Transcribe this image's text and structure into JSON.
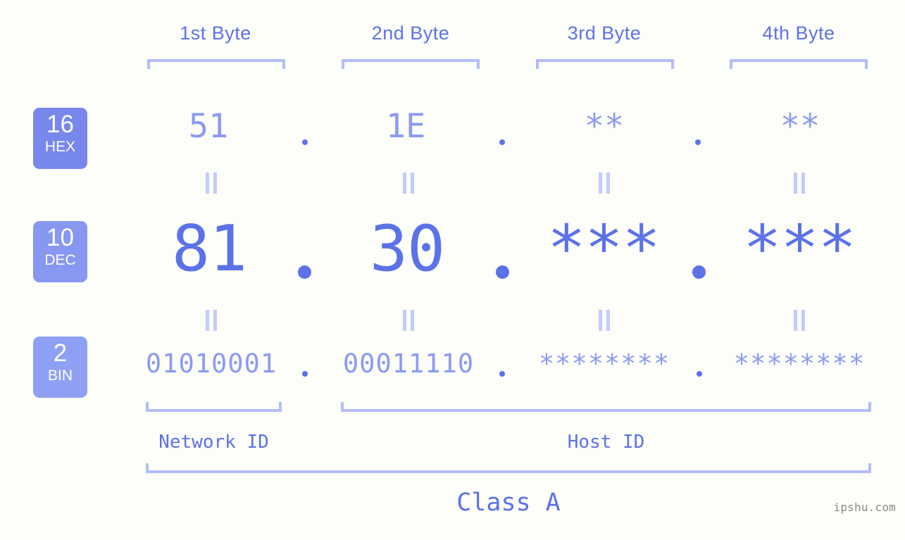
{
  "watermark": "ipshu.com",
  "byte_headers": [
    {
      "label": "1st Byte"
    },
    {
      "label": "2nd Byte"
    },
    {
      "label": "3rd Byte"
    },
    {
      "label": "4th Byte"
    }
  ],
  "bases": [
    {
      "number": "16",
      "name": "HEX",
      "color": "#7787ec"
    },
    {
      "number": "10",
      "name": "DEC",
      "color": "#8897ef"
    },
    {
      "number": "2",
      "name": "BIN",
      "color": "#8fa0f4"
    }
  ],
  "rows": {
    "hex": {
      "values": [
        "51",
        "1E",
        "**",
        "**"
      ]
    },
    "dec": {
      "values": [
        "81",
        "30",
        "***",
        "***"
      ]
    },
    "bin": {
      "values": [
        "01010001",
        "00011110",
        "********",
        "********"
      ]
    }
  },
  "separator": ".",
  "equality_symbol": "=",
  "segments": {
    "network_id": "Network ID",
    "host_id": "Host ID",
    "class": "Class A"
  },
  "colors": {
    "background": "#fdfdfa",
    "accent_strong": "#5c72e8",
    "accent_light": "#8b9bf2",
    "bracket": "#b3bdf7",
    "equality": "#c3ccfa",
    "watermark": "#8a8a8a"
  }
}
